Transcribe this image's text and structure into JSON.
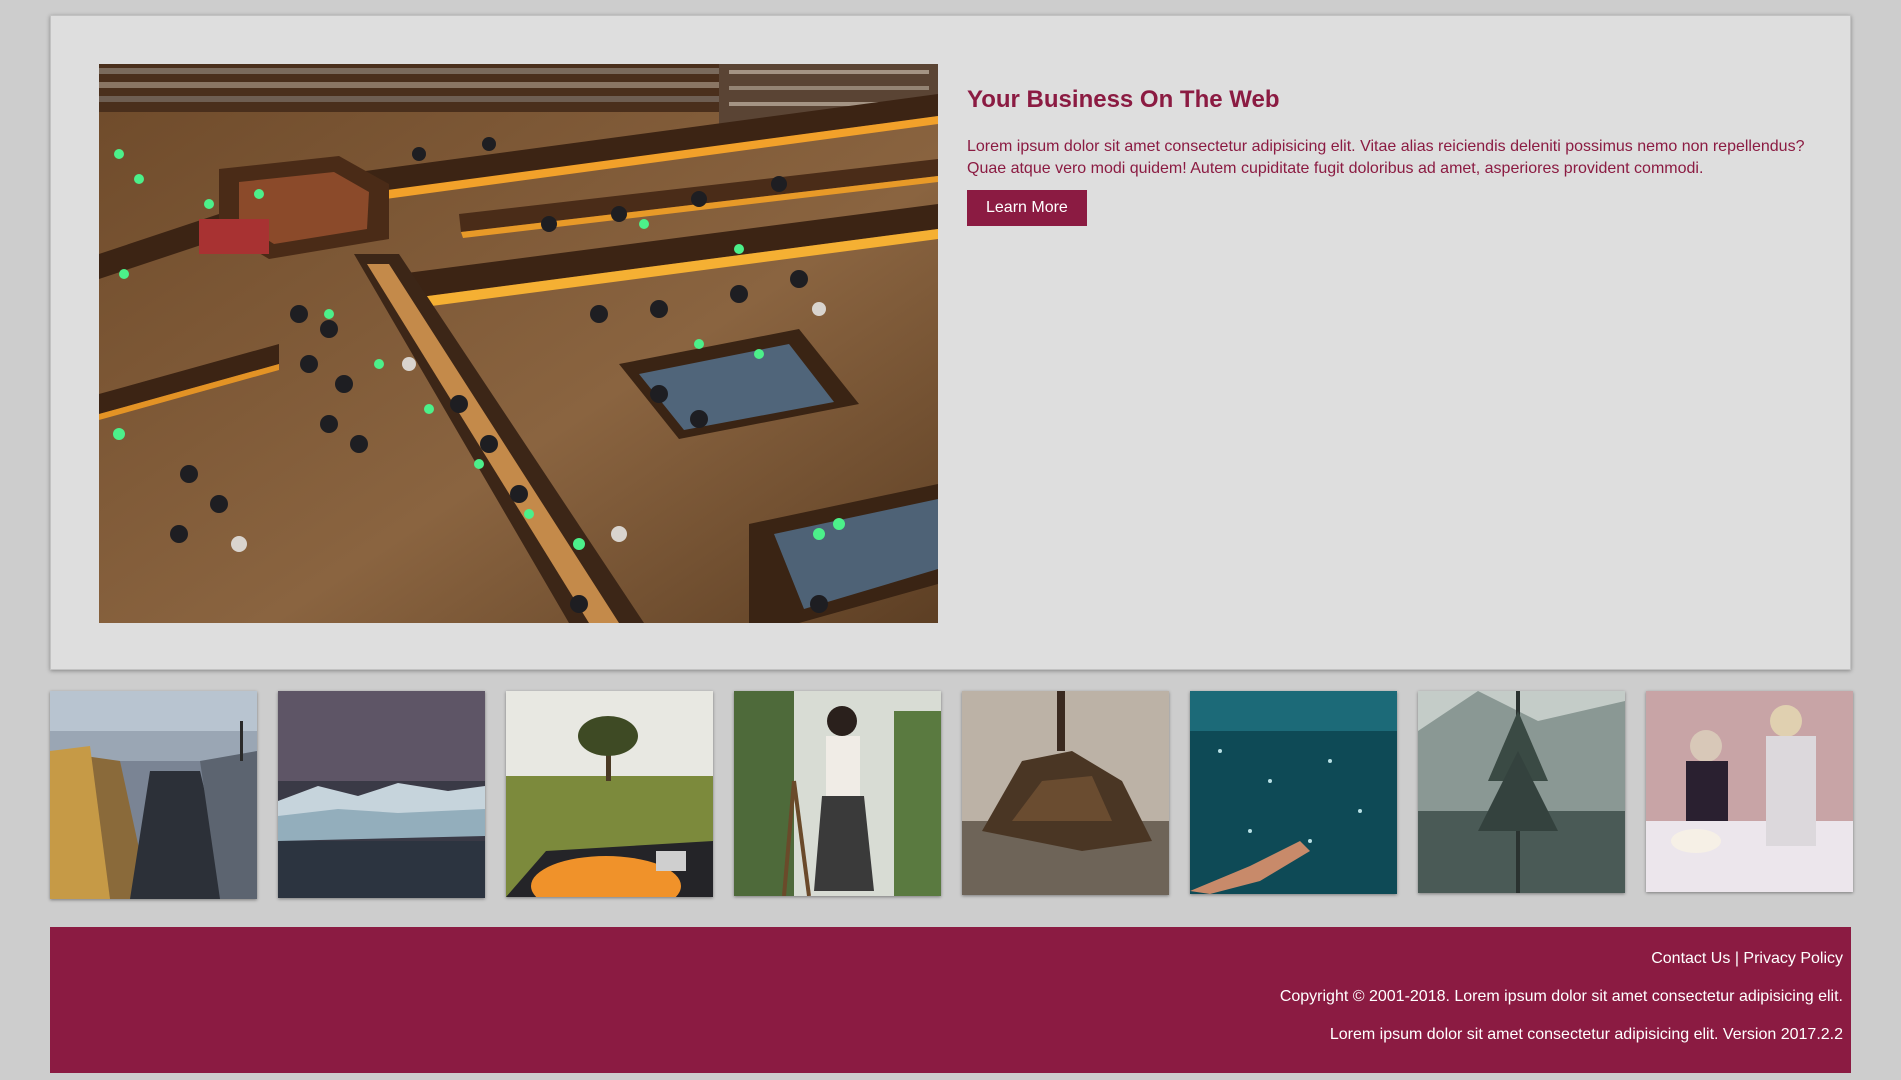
{
  "hero": {
    "image_alt": "library reading room photo",
    "title": "Your Business On The Web",
    "description": "Lorem ipsum dolor sit amet consectetur adipisicing elit. Vitae alias reiciendis deleniti possimus nemo non repellendus? Quae atque vero modi quidem! Autem cupiditate fugit doloribus ad amet, asperiores provident commodi.",
    "button_label": "Learn More"
  },
  "gallery": {
    "items": [
      {
        "name": "shipyard-photo"
      },
      {
        "name": "glacier-photo"
      },
      {
        "name": "tree-field-photo"
      },
      {
        "name": "woman-studio-photo"
      },
      {
        "name": "driftwood-photo"
      },
      {
        "name": "underwater-photo"
      },
      {
        "name": "snowy-forest-photo"
      },
      {
        "name": "vintage-party-photo"
      }
    ]
  },
  "footer": {
    "contact_label": "Contact Us",
    "separator": "|",
    "privacy_label": "Privacy Policy",
    "copyright": "Copyright © 2001-2018. Lorem ipsum dolor sit amet consectetur adipisicing elit.",
    "version_line": "Lorem ipsum dolor sit amet consectetur adipisicing elit. Version 2017.2.2"
  },
  "colors": {
    "page_background": "#cdcdcd",
    "panel_background": "#dedede",
    "accent": "#8b1b42",
    "footer_text": "#ffffff"
  }
}
